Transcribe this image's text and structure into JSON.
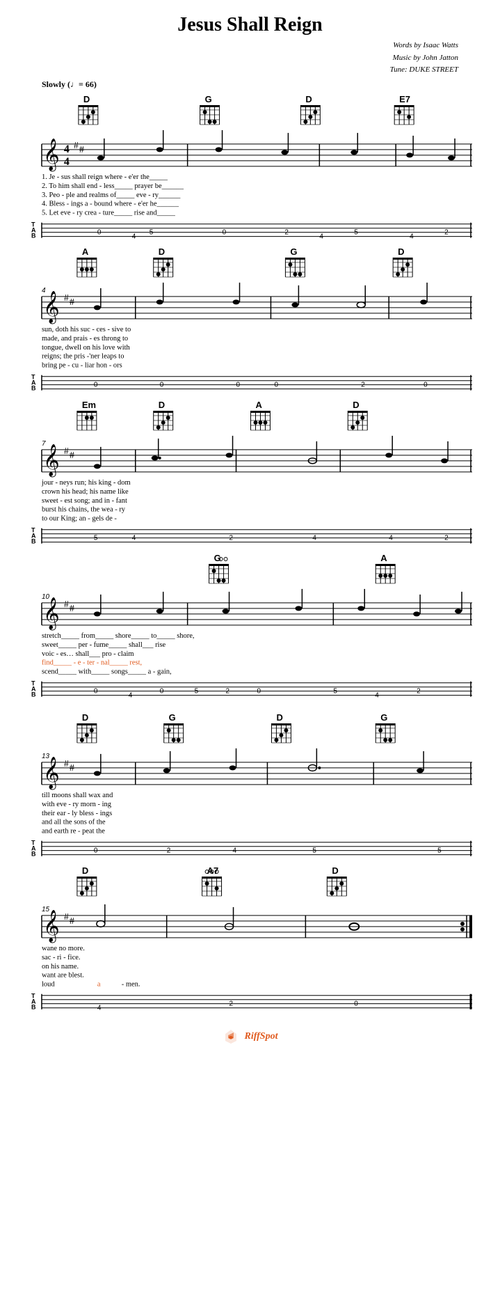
{
  "title": "Jesus Shall Reign",
  "attribution": {
    "line1": "Words by Isaac Watts",
    "line2": "Music by John Jatton",
    "line3": "Tune: DUKE STREET"
  },
  "tempo": "Slowly (♩= 66)",
  "footer": {
    "brand": "RiffSpot",
    "icon": "riffspot-logo"
  },
  "sections": [
    {
      "id": "section1",
      "measure_start": 1,
      "chords": [
        "D",
        "G",
        "D",
        "E7"
      ],
      "chord_positions": [
        90,
        270,
        430,
        565
      ],
      "lyrics": [
        "1. Je  -  sus    shall    reign    where    -    e'er    the_____",
        "2. To    him    shall    end  -   less_____    prayer   be______",
        "3. Peo -  ple    and     realms   of_____      eve -    ry______",
        "4. Bless - ings   a  -   bound    where  -     e'er    he______",
        "5. Let    eve  -  ry     crea  -  ture_____    rise    and_____"
      ],
      "tab": "0    4  5         0    2  4  5      4  2"
    },
    {
      "id": "section2",
      "measure_start": 4,
      "chords": [
        "A",
        "D",
        "G",
        "D"
      ],
      "chord_positions": [
        90,
        200,
        390,
        545
      ],
      "lyrics": [
        "sun,          doth    his   suc  -  ces  -  sive    to",
        "made,         and     prais - es   throng    to",
        "tongue,       dwell   on    his   love       with",
        "reigns;       the     pris -'ner   leaps      to",
        "bring         pe  -   cu  -  liar  hon  -     ors"
      ],
      "tab": "0     0       0  0      2    0"
    },
    {
      "id": "section3",
      "measure_start": 7,
      "chords": [
        "Em",
        "D",
        "A",
        "D"
      ],
      "chord_positions": [
        90,
        200,
        340,
        480
      ],
      "lyrics": [
        "jour  -  neys     run;        his    king  -  dom",
        "crown    his      head;       his    name    like",
        "sweet  - est      song;       and    in  -  fant",
        "burst    his      chains,     the    wea  -  ry",
        "to       our      King;       an  -  gels    de -"
      ],
      "tab": "5    4    2        4    4  2"
    },
    {
      "id": "section4",
      "measure_start": 10,
      "chords": [
        "G",
        "A"
      ],
      "chord_positions": [
        280,
        520
      ],
      "lyrics": [
        "stretch_____  from_____   shore_____  to_____   shore,",
        "sweet_____    per    -   fume_____   shall___  rise",
        "voic -  es…  shall___   pro    -    claim",
        "find_____ -   e    -    ter    -    nal_____  rest,",
        "scend_____   with_____  songs_____  a    -    gain,"
      ],
      "tab": "0  4   0  5    2  0      5  4  2"
    },
    {
      "id": "section5",
      "measure_start": 13,
      "chords": [
        "D",
        "G",
        "D",
        "G"
      ],
      "chord_positions": [
        90,
        215,
        370,
        520
      ],
      "lyrics": [
        "till          moons    shall   wax        and",
        "with          eve  -   ry      morn  -    ing",
        "their         ear  -   ly      bless -    ings",
        "and           all     the     sons    of  the",
        "and           earth    re  -   peat       the"
      ],
      "tab": "0    2      4  5            5"
    },
    {
      "id": "section6",
      "measure_start": 15,
      "chords": [
        "D",
        "A7",
        "D"
      ],
      "chord_positions": [
        90,
        270,
        450
      ],
      "lyrics": [
        "wane       no          more.",
        "sac  -     ri    -     fice.",
        "on         his         name.",
        "want       are         blest.",
        "loud       a      -    men."
      ],
      "tab": "4    2         0"
    }
  ]
}
